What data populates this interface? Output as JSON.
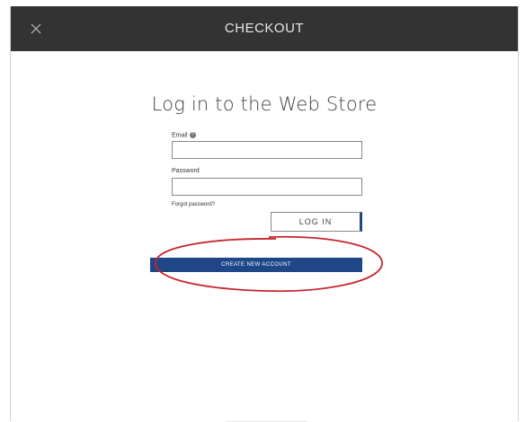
{
  "header": {
    "title": "CHECKOUT",
    "close_icon": "close-icon"
  },
  "login": {
    "title": "Log in to the Web Store",
    "email_label": "Email",
    "email_value": "",
    "help_icon": "help-icon",
    "password_label": "Password",
    "password_value": "",
    "forgot_label": "Forgot password?",
    "login_button": "LOG IN",
    "create_account_button": "CREATE NEW ACCOUNT"
  },
  "colors": {
    "header_bg": "#333333",
    "accent": "#1f4788",
    "highlight": "#c8242b"
  }
}
